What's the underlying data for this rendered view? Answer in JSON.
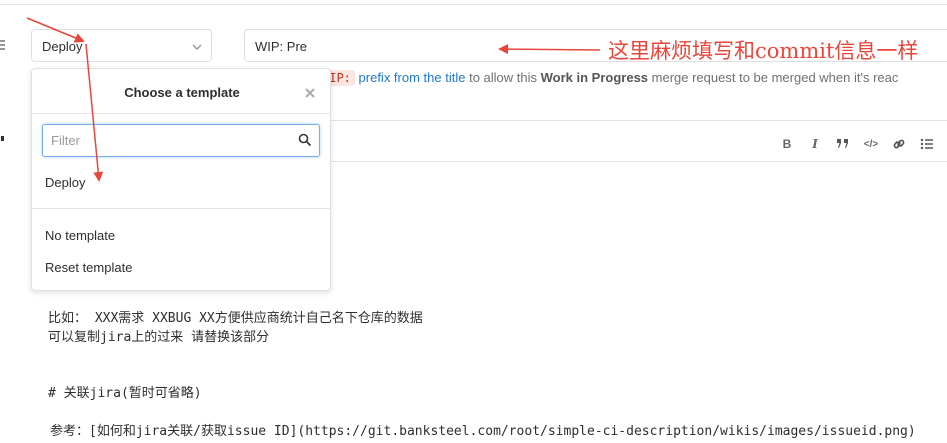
{
  "form": {
    "left_label_fragment_1": " ",
    "template_selected": "Deploy",
    "title_value": "WIP: Pre"
  },
  "help": {
    "code": "WIP:",
    "link": "prefix from the title",
    "middle": " to allow this ",
    "bold": "Work in Progress",
    "tail": " merge request to be merged when it's reac"
  },
  "template_dropdown": {
    "title": "Choose a template",
    "close_glyph": "✖",
    "filter_placeholder": "Filter",
    "items": [
      "Deploy"
    ],
    "footer_items": [
      "No template",
      "Reset template"
    ]
  },
  "toolbar": {
    "bold": "B",
    "italic": "I",
    "quote": "❝",
    "code": "</>",
    "link": "∞",
    "list": "☰"
  },
  "editor": {
    "lines": [
      "比如： XXX需求  XXBUG  XX方便供应商统计自己名下仓库的数据",
      "可以复制jira上的过来 请替换该部分",
      "# 关联jira(暂时可省略)",
      " 参考：[如何和jira关联/获取issue ID](https://git.banksteel.com/root/simple-ci-description/wikis/images/issueid.png)"
    ]
  },
  "annotation": {
    "text": "这里麻烦填写和commit信息一样",
    "color": "#e8463a"
  },
  "icons": {
    "chevron": "chevron-down-icon",
    "search": "search-icon",
    "close": "close-icon"
  }
}
